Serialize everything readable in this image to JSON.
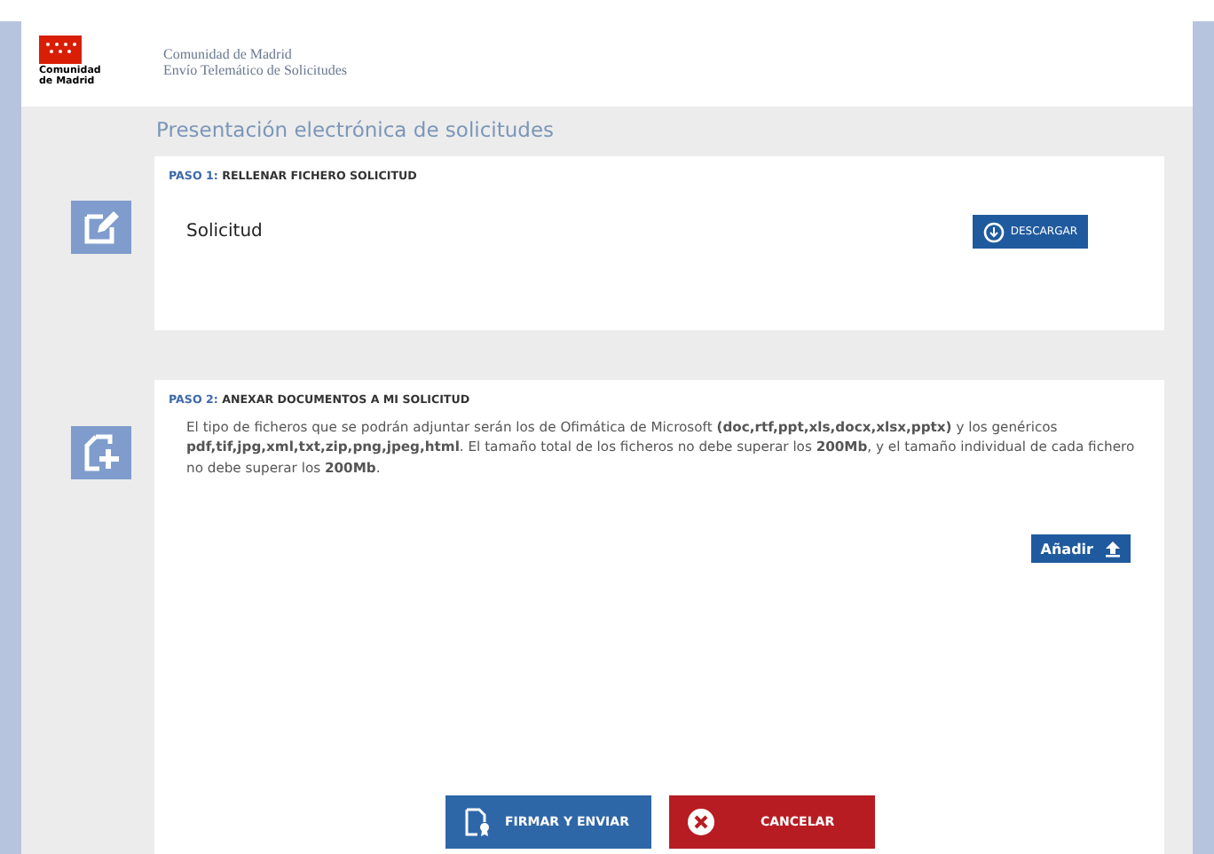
{
  "header": {
    "logo_text": "Comunidad de Madrid",
    "org": "Comunidad de Madrid",
    "service": "Envío Telemático de Solicitudes"
  },
  "page_title": "Presentación electrónica de solicitudes",
  "steps": [
    {
      "kind": "download",
      "step": "PASO 1:",
      "title": "RELLENAR FICHERO SOLICITUD",
      "label": "Solicitud",
      "button": "DESCARGAR"
    },
    {
      "kind": "attach",
      "step": "PASO 2:",
      "title": "ANEXAR DOCUMENTOS A MI SOLICITUD",
      "text": "El tipo de ficheros que se podrán adjuntar serán los de Ofimática de Microsoft **(doc,rtf,ppt,xls,docx,xlsx,pptx)** y los genéricos **pdf,tif,jpg,xml,txt,zip,png,jpeg,html**. El tamaño total de los ficheros no debe superar los **200Mb**, y el tamaño individual de cada fichero no debe superar los **200Mb**.",
      "button": "Añadir"
    }
  ],
  "actions": [
    {
      "kind": "sign",
      "label": "FIRMAR Y ENVIAR"
    },
    {
      "kind": "cancel",
      "label": "CANCELAR"
    }
  ]
}
